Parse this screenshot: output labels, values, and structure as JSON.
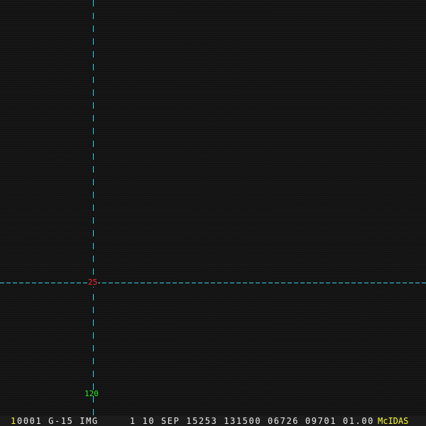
{
  "image": {
    "overlay_color": "#2fd6e6",
    "latitude_label": "25",
    "latitude_label_color": "#ff2a2a",
    "longitude_label": "120",
    "longitude_label_color": "#22ee22"
  },
  "status_bar": {
    "frame_number": "1",
    "info": "0001 G-15 IMG     1 10 SEP 15253 131500 06726 09701 01.00",
    "brand": "McIDAS",
    "highlight_color": "#ffff33"
  }
}
